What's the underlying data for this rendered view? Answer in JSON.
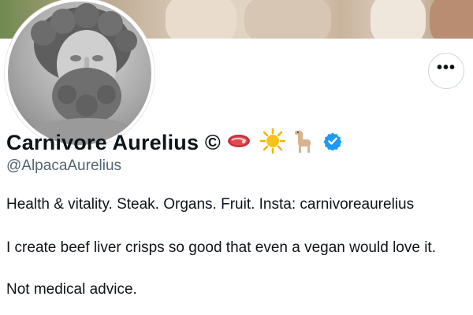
{
  "profile": {
    "display_name": "Carnivore Aurelius ©",
    "handle": "@AlpacaAurelius",
    "name_emojis": [
      "steak-icon",
      "sun-icon",
      "llama-icon"
    ],
    "verified": true,
    "verified_color": "#1d9bf0",
    "bio": {
      "line1": "Health & vitality. Steak. Organs. Fruit. Insta: carnivoreaurelius",
      "line2": "I create beef liver crisps so good that even a vegan would love it.",
      "line3": "Not medical advice."
    }
  },
  "actions": {
    "more_label": "•••"
  },
  "colors": {
    "text": "#0f1419",
    "secondary": "#536471",
    "border": "#cfd9de",
    "accent": "#1d9bf0"
  }
}
